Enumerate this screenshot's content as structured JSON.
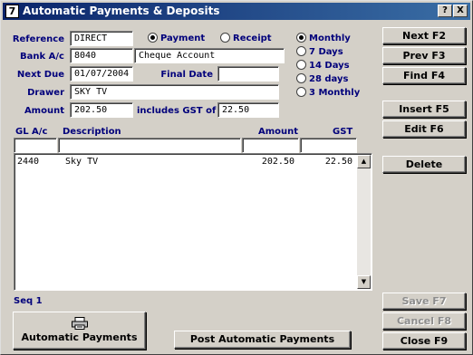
{
  "window": {
    "icon_glyph": "7",
    "title": "Automatic Payments & Deposits",
    "help_label": "?",
    "close_label": "X"
  },
  "form": {
    "reference_label": "Reference",
    "reference_value": "DIRECT",
    "payment_label": "Payment",
    "receipt_label": "Receipt",
    "type_selected": "Payment",
    "bank_label": "Bank A/c",
    "bank_code": "8040",
    "bank_name": "Cheque Account",
    "next_due_label": "Next Due",
    "next_due_value": "01/07/2004",
    "final_date_label": "Final Date",
    "final_date_value": "",
    "drawer_label": "Drawer",
    "drawer_value": "SKY TV",
    "amount_label": "Amount",
    "amount_value": "202.50",
    "gst_label": "includes GST of",
    "gst_value": "22.50"
  },
  "frequency": {
    "selected": "Monthly",
    "options": [
      "Monthly",
      "7 Days",
      "14 Days",
      "28 days",
      "3 Monthly"
    ]
  },
  "grid": {
    "headers": {
      "gl": "GL A/c",
      "description": "Description",
      "amount": "Amount",
      "gst": "GST"
    },
    "rows": [
      {
        "gl": "2440",
        "description": "Sky TV",
        "amount": "202.50",
        "gst": "22.50"
      }
    ]
  },
  "footer": {
    "seq_label": "Seq 1",
    "automatic_payments_label": "Automatic Payments",
    "post_label": "Post Automatic Payments"
  },
  "buttons": {
    "next": "Next F2",
    "prev": "Prev F3",
    "find": "Find F4",
    "insert": "Insert F5",
    "edit": "Edit F6",
    "delete": "Delete",
    "save": "Save F7",
    "cancel": "Cancel F8",
    "close": "Close F9"
  },
  "icons": {
    "app": "app-icon",
    "printer": "printer-icon",
    "scroll_up": "scroll-up-icon",
    "scroll_down": "scroll-down-icon"
  }
}
